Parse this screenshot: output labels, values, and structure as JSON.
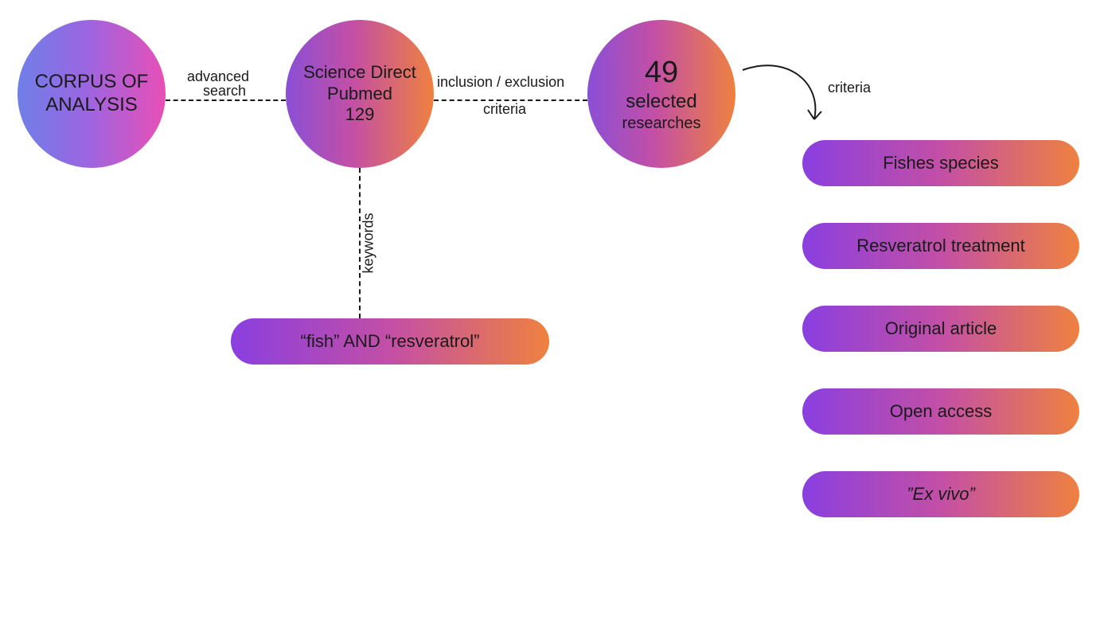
{
  "circle1": {
    "line1": "CORPUS OF",
    "line2": "ANALYSIS"
  },
  "conn1": {
    "line1": "advanced",
    "line2": "search"
  },
  "circle2": {
    "line1": "Science Direct",
    "line2": "Pubmed",
    "count": "129"
  },
  "conn2": {
    "line1": "inclusion / exclusion",
    "line2": "criteria"
  },
  "circle3": {
    "count": "49",
    "line1": "selected",
    "line2": "researches"
  },
  "vlabel": "keywords",
  "keywordsPill": "“fish” AND “resveratrol”",
  "arrowLabel": "criteria",
  "criteria": {
    "items": [
      {
        "label": "Fishes species",
        "italic": false
      },
      {
        "label": "Resveratrol treatment",
        "italic": false
      },
      {
        "label": "Original article",
        "italic": false
      },
      {
        "label": "Open access",
        "italic": false
      },
      {
        "label": "”Ex vivo”",
        "italic": true
      }
    ]
  }
}
